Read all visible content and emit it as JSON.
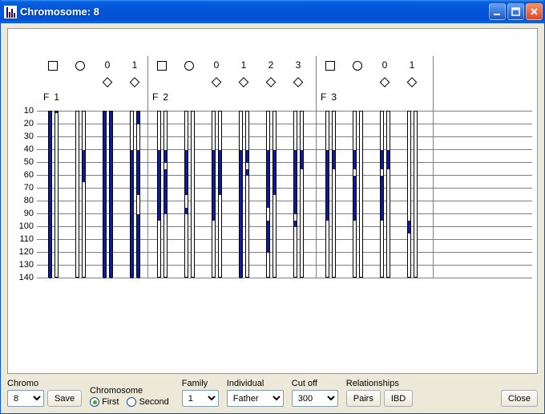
{
  "window": {
    "title": "Chromosome: 8"
  },
  "controls": {
    "chromo_label": "Chromo",
    "chromo_value": "8",
    "save_label": "Save",
    "chromosome_label": "Chromosome",
    "radio_first": "First",
    "radio_second": "Second",
    "family_label": "Family",
    "family_value": "1",
    "individual_label": "Individual",
    "individual_value": "Father",
    "cutoff_label": "Cut off",
    "cutoff_value": "300",
    "relationships_label": "Relationships",
    "pairs_label": "Pairs",
    "ibd_label": "IBD",
    "close_label": "Close"
  },
  "chart_data": {
    "type": "bar",
    "title": "",
    "xlabel": "",
    "ylabel": "",
    "ylim": [
      10,
      140
    ],
    "y_ticks": [
      10,
      20,
      30,
      40,
      50,
      60,
      70,
      80,
      90,
      100,
      110,
      120,
      130,
      140
    ],
    "families": [
      {
        "id": "F1",
        "columns": [
          {
            "symbol": "sq",
            "header": ""
          },
          {
            "symbol": "ci",
            "header": ""
          },
          {
            "symbol": "di",
            "header": "0"
          },
          {
            "symbol": "di",
            "header": "1"
          }
        ],
        "tracks": [
          [
            [
              10,
              140
            ]
          ],
          [
            [
              10,
              10
            ]
          ],
          [],
          [
            [
              40,
              65
            ]
          ],
          [
            [
              10,
              140
            ]
          ],
          [
            [
              10,
              140
            ]
          ],
          [
            [
              40,
              140
            ]
          ],
          [
            [
              10,
              20
            ],
            [
              40,
              75
            ],
            [
              90,
              140
            ]
          ]
        ]
      },
      {
        "id": "F2",
        "columns": [
          {
            "symbol": "sq",
            "header": ""
          },
          {
            "symbol": "ci",
            "header": ""
          },
          {
            "symbol": "di",
            "header": "0"
          },
          {
            "symbol": "di",
            "header": "1"
          },
          {
            "symbol": "di",
            "header": "2"
          },
          {
            "symbol": "di",
            "header": "3"
          }
        ],
        "tracks": [
          [
            [
              40,
              95
            ]
          ],
          [
            [
              40,
              50
            ],
            [
              55,
              90
            ]
          ],
          [
            [
              40,
              75
            ],
            [
              85,
              90
            ]
          ],
          [],
          [
            [
              40,
              95
            ]
          ],
          [
            [
              40,
              75
            ]
          ],
          [
            [
              40,
              140
            ]
          ],
          [
            [
              40,
              50
            ],
            [
              55,
              60
            ]
          ],
          [
            [
              40,
              85
            ],
            [
              95,
              120
            ]
          ],
          [
            [
              40,
              75
            ]
          ],
          [
            [
              40,
              90
            ],
            [
              95,
              100
            ]
          ],
          [
            [
              40,
              55
            ]
          ]
        ]
      },
      {
        "id": "F3",
        "columns": [
          {
            "symbol": "sq",
            "header": ""
          },
          {
            "symbol": "ci",
            "header": ""
          },
          {
            "symbol": "di",
            "header": "0"
          },
          {
            "symbol": "di",
            "header": "1"
          }
        ],
        "tracks": [
          [
            [
              40,
              95
            ]
          ],
          [
            [
              40,
              55
            ]
          ],
          [
            [
              40,
              55
            ],
            [
              60,
              95
            ]
          ],
          [],
          [
            [
              40,
              55
            ],
            [
              60,
              95
            ]
          ],
          [
            [
              40,
              55
            ]
          ],
          [
            [
              95,
              105
            ]
          ],
          []
        ]
      }
    ]
  }
}
